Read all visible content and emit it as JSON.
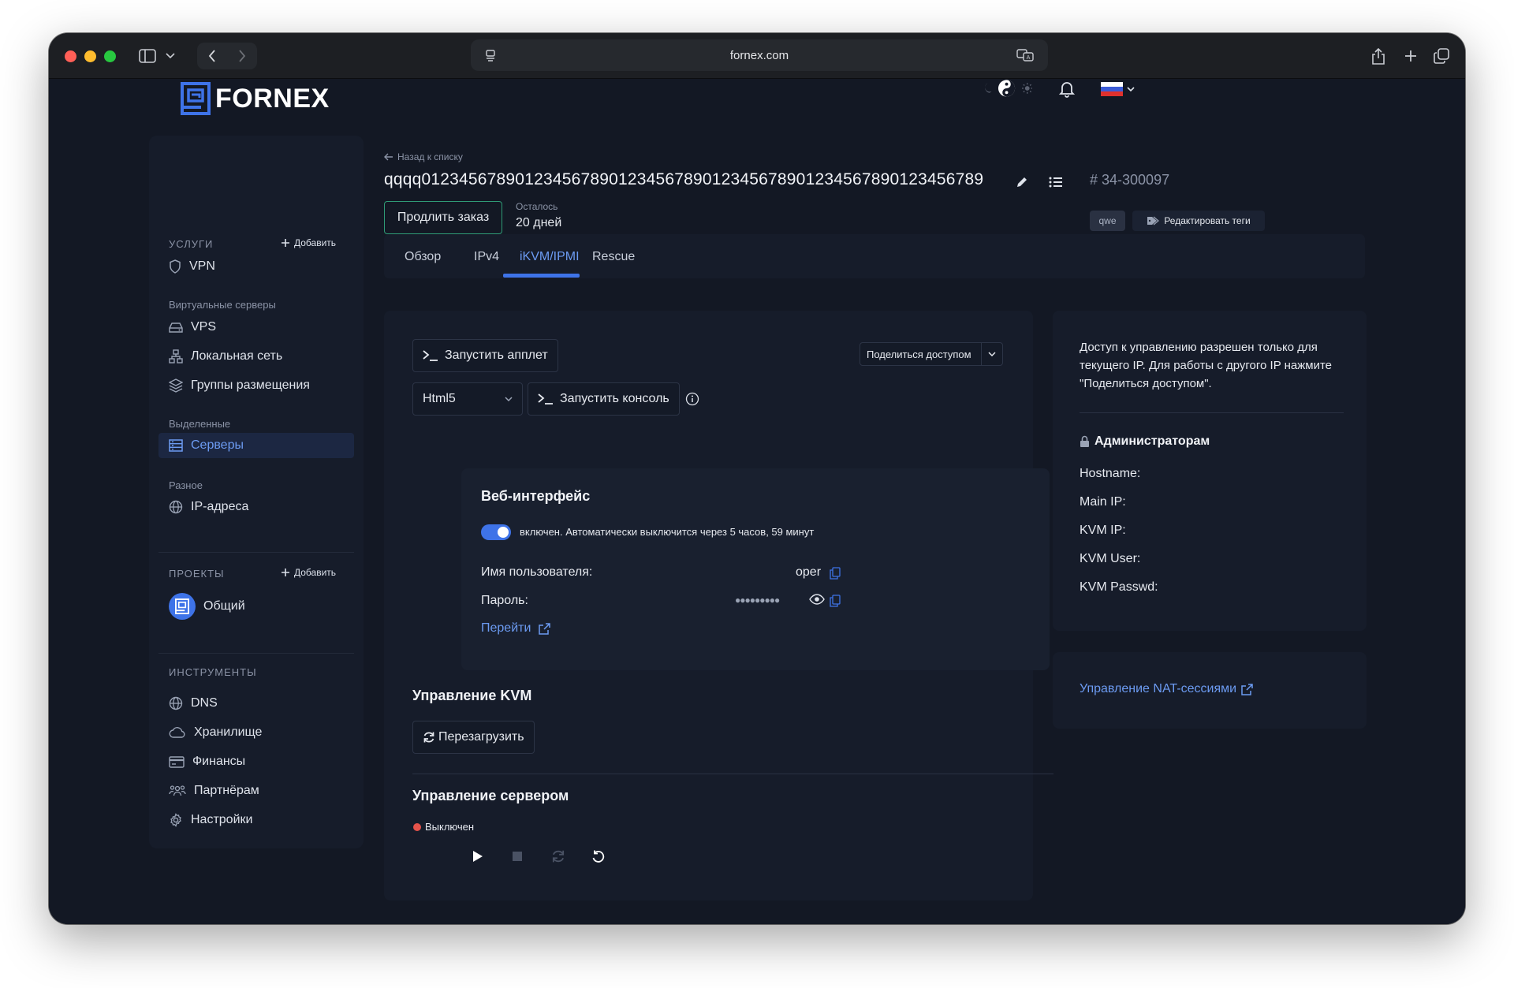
{
  "browser": {
    "url": "fornex.com"
  },
  "brand": {
    "name": "FORNEX"
  },
  "sidebar": {
    "services_header": "УСЛУГИ",
    "services_add": "Добавить",
    "vpn": "VPN",
    "virtual_caption": "Виртуальные серверы",
    "vps": "VPS",
    "local_net": "Локальная сеть",
    "groups": "Группы размещения",
    "dedicated_caption": "Выделенные",
    "servers": "Серверы",
    "misc_caption": "Разное",
    "ip": "IP-адреса",
    "projects_header": "ПРОЕКТЫ",
    "projects_add": "Добавить",
    "project_general": "Общий",
    "tools_header": "ИНСТРУМЕНТЫ",
    "tools": [
      "DNS",
      "Хранилище",
      "Финансы",
      "Партнёрам",
      "Настройки"
    ]
  },
  "server": {
    "back": "Назад к списку",
    "name": "qqqq012345678901234567890123456789012345678901234567890123456789",
    "order_number": "# 34-300097",
    "renew_label": "Продлить заказ",
    "remaining_label": "Осталось",
    "remaining_value": "20 дней",
    "tag": "qwe",
    "edit_tags": "Редактировать теги"
  },
  "tabs": [
    "Обзор",
    "IPv4",
    "iKVM/IPMI",
    "Rescue"
  ],
  "kvm": {
    "launch_applet": "Запустить апплет",
    "share_access": "Поделиться доступом",
    "console_type": "Html5",
    "launch_console": "Запустить консоль",
    "web_title": "Веб-интерфейс",
    "web_status": "включен. Автоматически выключится через 5 часов, 59 минут",
    "user_label": "Имя пользователя:",
    "user_value": "oper",
    "password_label": "Пароль:",
    "password_mask": "●●●●●●●●●",
    "goto": "Перейти",
    "kvm_title": "Управление KVM",
    "reboot": "Перезагрузить",
    "server_title": "Управление сервером",
    "power_state": "Выключен"
  },
  "info": {
    "notice": "Доступ к управлению разрешен только для текущего IP. Для работы с другого IP нажмите \"Поделиться доступом\".",
    "admins_title": "Администраторам",
    "fields": [
      "Hostname:",
      "Main IP:",
      "KVM IP:",
      "KVM User:",
      "KVM Passwd:"
    ],
    "nat_link": "Управление NAT-сессиями"
  },
  "colors": {
    "accent": "#3e73e8",
    "link": "#6c9bf2",
    "green": "#2f9b76",
    "off": "#e5534b"
  }
}
